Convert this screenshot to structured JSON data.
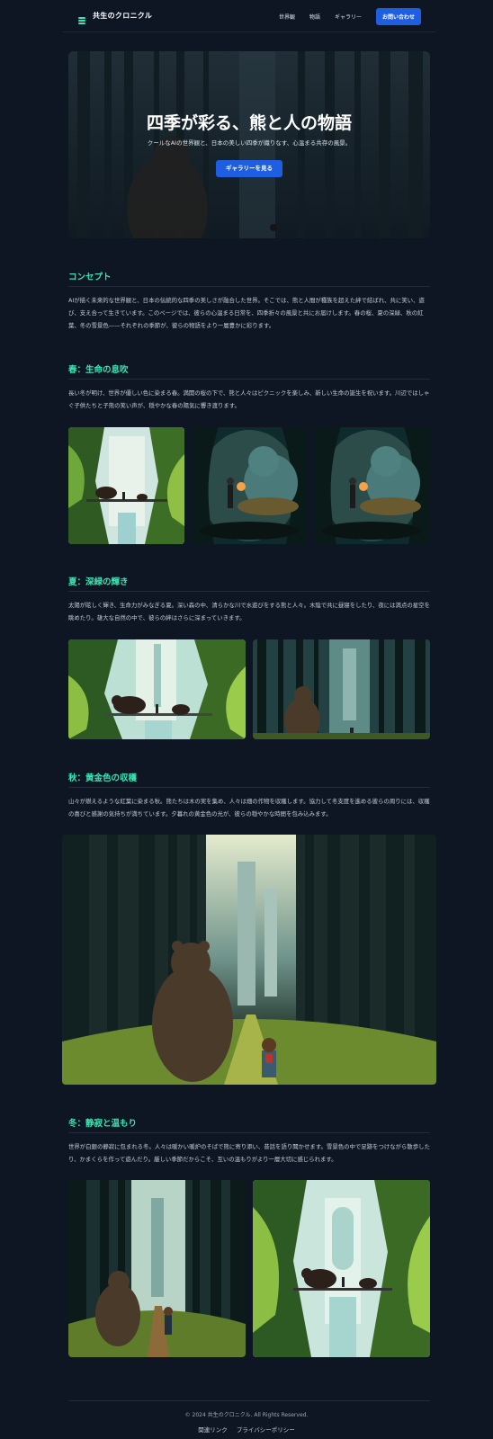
{
  "header": {
    "brand": "共生のクロニクル",
    "nav": [
      "世界観",
      "物語",
      "ギャラリー"
    ],
    "cta": "お問い合わせ"
  },
  "hero": {
    "title": "四季が彩る、熊と人の物語",
    "subtitle": "クールなAIの世界観と、日本の美しい四季が織りなす、心温まる共存の風景。",
    "button": "ギャラリーを見る"
  },
  "concept": {
    "title": "コンセプト",
    "body": "AIが描く未来的な世界観と、日本の伝統的な四季の美しさが融合した世界。そこでは、熊と人間が種族を超えた絆で結ばれ、共に笑い、遊び、支え合って生きています。このページでは、彼らの心温まる日常を、四季折々の風景と共にお届けします。春の桜、夏の深緑、秋の紅葉、冬の雪景色——それぞれの季節が、彼らの物語をより一層豊かに彩ります。"
  },
  "spring": {
    "title": "春：生命の息吹",
    "body": "長い冬が明け、世界が優しい色に染まる春。満開の桜の下で、熊と人々はピクニックを楽しみ、新しい生命の誕生を祝います。川辺ではしゃぐ子供たちと子熊の笑い声が、穏やかな春の陽気に響き渡ります。"
  },
  "summer": {
    "title": "夏：深緑の輝き",
    "body": "太陽が眩しく輝き、生命力がみなぎる夏。深い森の中、清らかな川で水遊びをする熊と人々。木陰で共に昼寝をしたり、夜には満点の星空を眺めたり。雄大な自然の中で、彼らの絆はさらに深まっていきます。"
  },
  "autumn": {
    "title": "秋：黄金色の収穫",
    "body": "山々が燃えるような紅葉に染まる秋。熊たちは木の実を集め、人々は畑の作物を収穫します。協力して冬支度を進める彼らの周りには、収穫の喜びと感謝の気持ちが満ちています。夕暮れの黄金色の光が、彼らの穏やかな時間を包み込みます。"
  },
  "winter": {
    "title": "冬：静寂と温もり",
    "body": "世界が白銀の静寂に包まれる冬。人々は暖かい暖炉のそばで熊に寄り添い、昔話を語り聞かせます。雪景色の中で足跡をつけながら散歩したり、かまくらを作って遊んだり。厳しい季節だからこそ、互いの温もりがより一層大切に感じられます。"
  },
  "footer": {
    "copyright": "© 2024 共生のクロニクル. All Rights Reserved.",
    "links": [
      "関連リンク",
      "プライバシーポリシー"
    ]
  },
  "colors": {
    "background": "#0e1623",
    "accent": "#3ee3b3",
    "button": "#1d5fe0"
  }
}
